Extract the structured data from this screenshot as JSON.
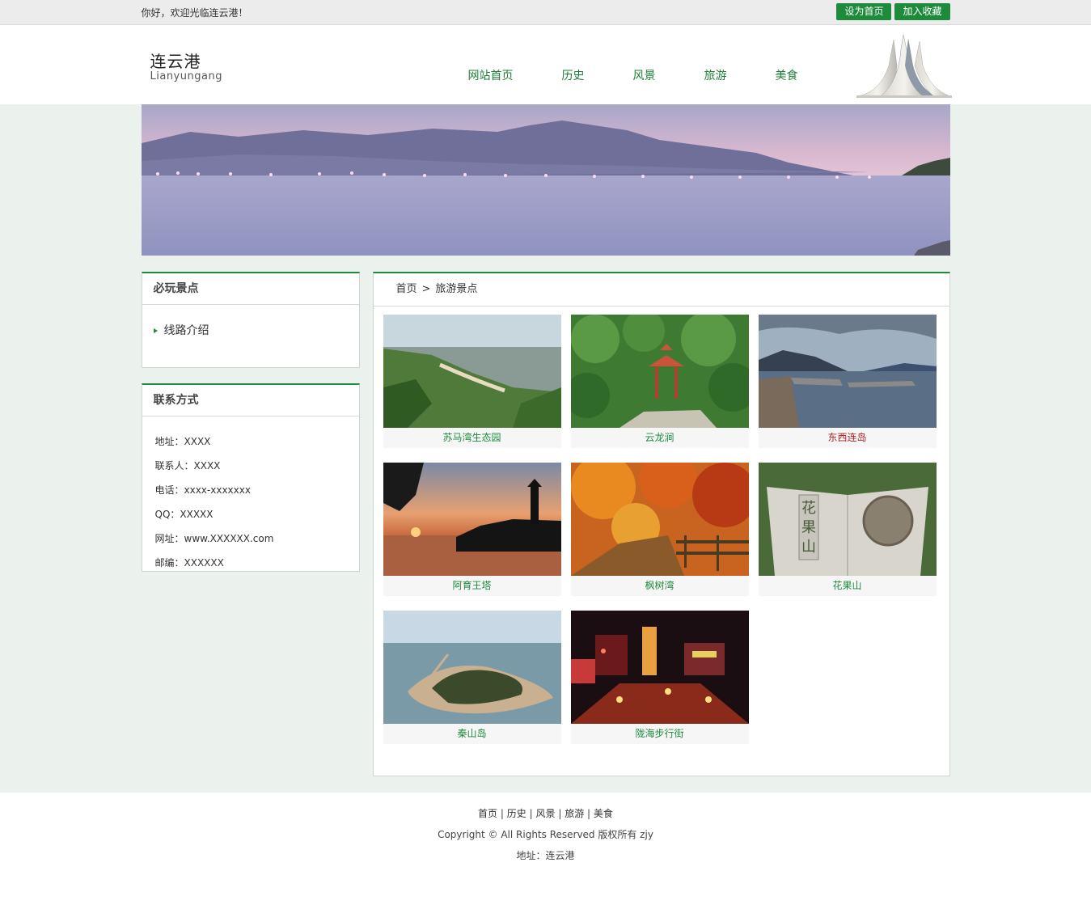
{
  "topbar": {
    "welcome": "你好，欢迎光临连云港！",
    "set_home": "设为首页",
    "add_favorite": "加入收藏"
  },
  "header": {
    "logo_cn": "连云港",
    "logo_en": "Lianyungang",
    "nav": [
      "网站首页",
      "历史",
      "风景",
      "旅游",
      "美食"
    ]
  },
  "sidebar": {
    "must_see_title": "必玩景点",
    "must_see_items": [
      "线路介绍"
    ],
    "contact_title": "联系方式",
    "contact_items": [
      "地址：XXXX",
      "联系人：XXXX",
      "电话：xxxx-xxxxxxx",
      "QQ：XXXXX",
      "网址：www.XXXXXX.com",
      "邮编：XXXXXX"
    ]
  },
  "breadcrumb": {
    "home": "首页",
    "separator": ">",
    "current": "旅游景点"
  },
  "spots": [
    "苏马湾生态园",
    "云龙涧",
    "东西连岛",
    "阿育王塔",
    "枫树湾",
    "花果山",
    "秦山岛",
    "陇海步行街"
  ],
  "footer": {
    "links": [
      "首页",
      "历史",
      "风景",
      "旅游",
      "美食"
    ],
    "link_separator": "|",
    "copyright": "Copyright © All Rights Reserved 版权所有 zjy",
    "address": "地址：连云港"
  },
  "colors": {
    "brand_green": "#1d8a3c",
    "page_bg": "#ebf1ec",
    "highlight_caption": "#b22222"
  }
}
